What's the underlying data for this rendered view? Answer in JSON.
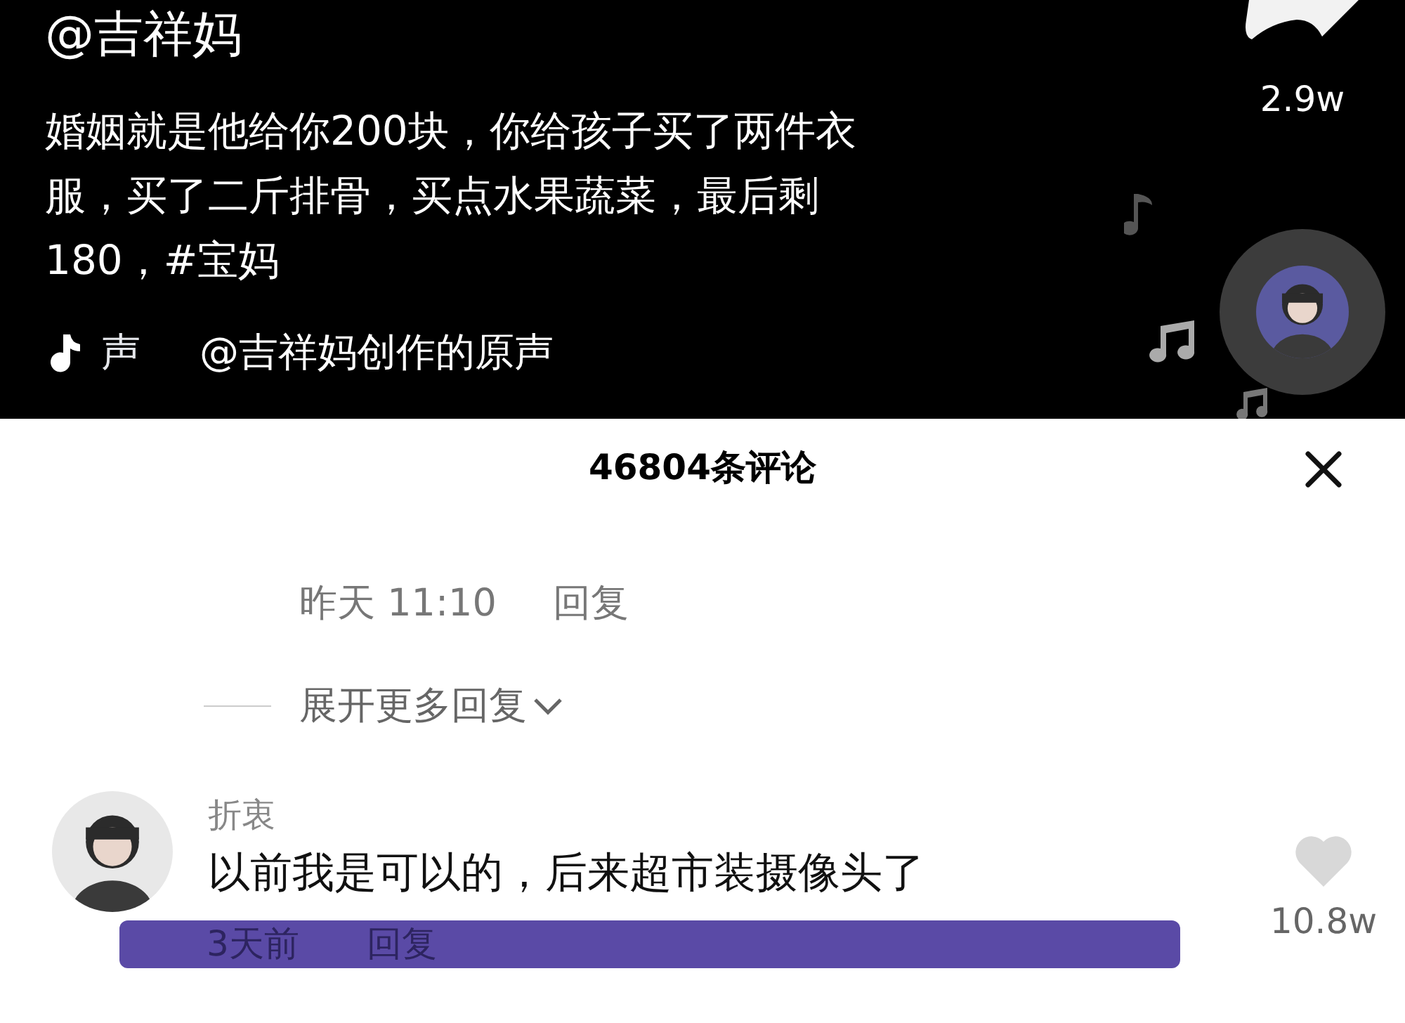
{
  "video": {
    "author": "@吉祥妈",
    "caption_lines": [
      "婚姻就是他给你200块，你给孩子买了两件衣",
      "服，买了二斤排骨，买点水果蔬菜，最后剩",
      "180，#宝妈"
    ],
    "music_label": "声",
    "music_title": "@吉祥妈创作的原声",
    "share_count": "2.9w"
  },
  "comments_panel": {
    "title": "46804条评论",
    "previous_reply": {
      "time": "昨天 11:10",
      "reply": "回复"
    },
    "expand_label": "展开更多回复",
    "comments": [
      {
        "user": "折衷",
        "text": "以前我是可以的，后来超市装摄像头了",
        "time": "3天前",
        "reply": "回复",
        "likes": "10.8w",
        "liked": false
      }
    ]
  }
}
